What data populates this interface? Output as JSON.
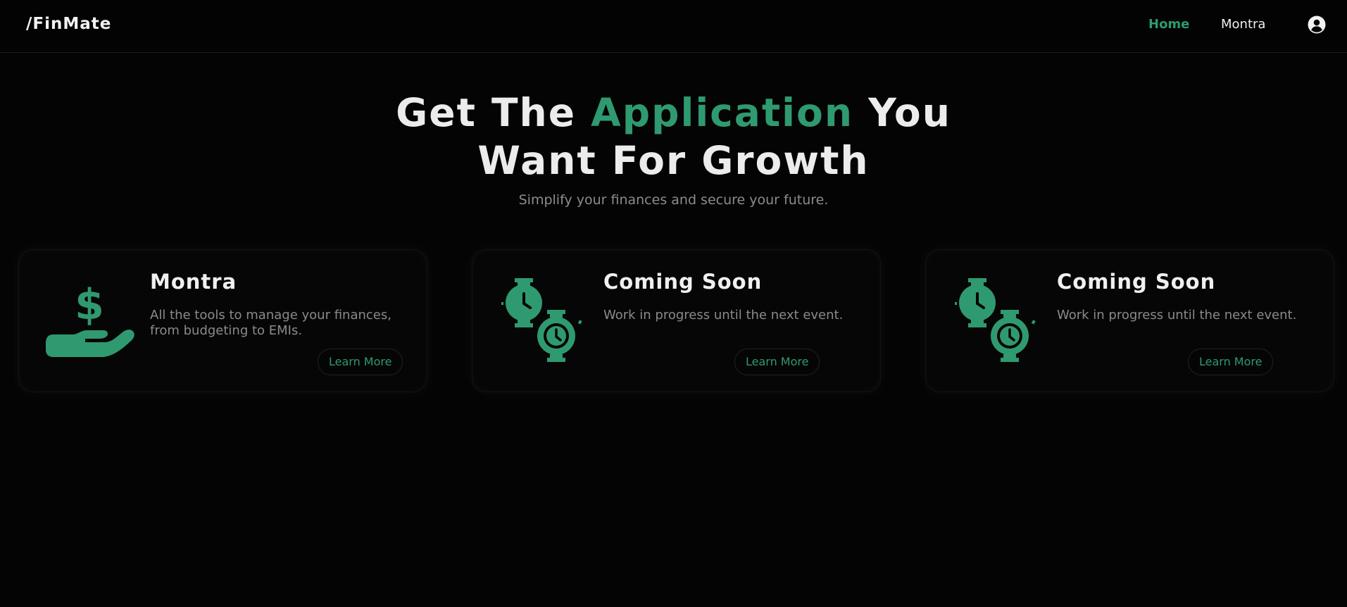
{
  "header": {
    "brand": "/FinMate",
    "nav": [
      {
        "label": "Home",
        "active": true
      },
      {
        "label": "Montra",
        "active": false
      }
    ],
    "profile_icon": "user-circle-icon"
  },
  "hero": {
    "title_part1": "Get The ",
    "title_accent": "Application",
    "title_part2": " You",
    "title_line2": "Want For Growth",
    "subtitle": "Simplify your finances and secure your future."
  },
  "cards": [
    {
      "icon": "hand-dollar-icon",
      "title": "Montra",
      "description": "All the tools to manage your finances, from budgeting to EMIs.",
      "button": "Learn More"
    },
    {
      "icon": "watches-icon",
      "title": "Coming Soon",
      "description": "Work in progress until the next event.",
      "button": "Learn More"
    },
    {
      "icon": "watches-icon",
      "title": "Coming Soon",
      "description": "Work in progress until the next event.",
      "button": "Learn More"
    }
  ],
  "colors": {
    "accent": "#2f9a6f",
    "background": "#040404",
    "muted_text": "#8a8a8a"
  }
}
